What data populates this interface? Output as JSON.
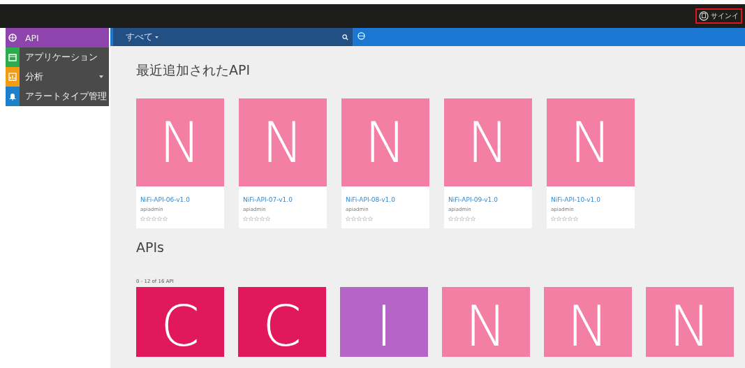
{
  "header": {
    "signin": {
      "label": "サインイ",
      "highlighted": true
    }
  },
  "sidebar": {
    "items": [
      {
        "label": "API",
        "color": "#8e44ad",
        "selected": true,
        "expandable": false
      },
      {
        "label": "アプリケーション",
        "color": "#2eaa4f",
        "selected": false,
        "expandable": false
      },
      {
        "label": "分析",
        "color": "#f39c12",
        "selected": false,
        "expandable": true
      },
      {
        "label": "アラートタイプ管理",
        "color": "#1e7fcb",
        "selected": false,
        "expandable": false
      }
    ]
  },
  "search": {
    "scope": "すべて"
  },
  "recent": {
    "title": "最近追加されたAPI",
    "cards": [
      {
        "letter": "N",
        "color": "#f47fa5",
        "name": "NiFi-API-06-v1.0",
        "owner": "apiadmin",
        "stars": 0
      },
      {
        "letter": "N",
        "color": "#f47fa5",
        "name": "NiFi-API-07-v1.0",
        "owner": "apiadmin",
        "stars": 0
      },
      {
        "letter": "N",
        "color": "#f47fa5",
        "name": "NiFi-API-08-v1.0",
        "owner": "apiadmin",
        "stars": 0
      },
      {
        "letter": "N",
        "color": "#f47fa5",
        "name": "NiFi-API-09-v1.0",
        "owner": "apiadmin",
        "stars": 0
      },
      {
        "letter": "N",
        "color": "#f47fa5",
        "name": "NiFi-API-10-v1.0",
        "owner": "apiadmin",
        "stars": 0
      }
    ]
  },
  "apis": {
    "title": "APIs",
    "count": "0 - 12 of 16 API",
    "tiles": [
      {
        "letter": "C",
        "color": "#e2185d"
      },
      {
        "letter": "C",
        "color": "#e2185d"
      },
      {
        "letter": "I",
        "color": "#b565c6"
      },
      {
        "letter": "N",
        "color": "#f47fa5"
      },
      {
        "letter": "N",
        "color": "#f47fa5"
      },
      {
        "letter": "N",
        "color": "#f47fa5"
      }
    ]
  }
}
